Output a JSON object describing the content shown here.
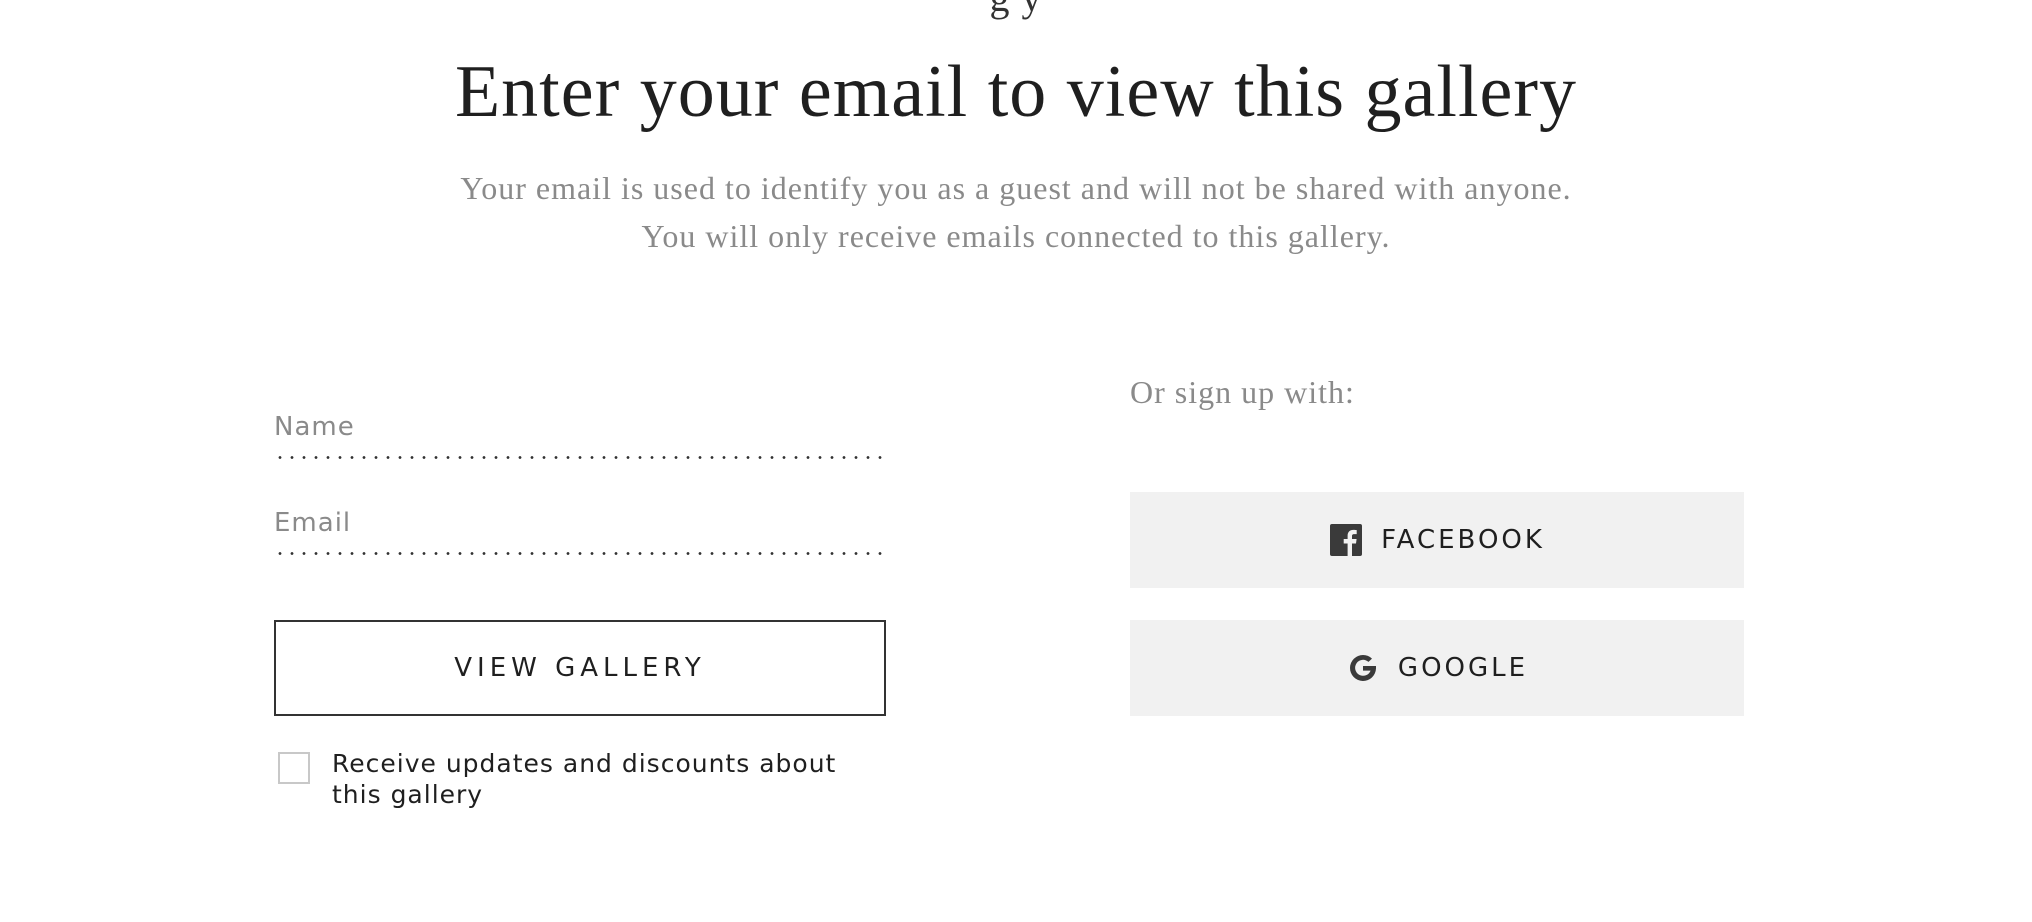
{
  "header": {
    "cut_text": "g    y",
    "title": "Enter your email to view this gallery",
    "subtitle_line1": "Your email is used to identify you as a guest and will not be shared with anyone.",
    "subtitle_line2": "You will only receive emails connected to this gallery."
  },
  "form": {
    "name_placeholder": "Name",
    "name_value": "",
    "email_placeholder": "Email",
    "email_value": "",
    "submit_label": "VIEW GALLERY",
    "checkbox_checked": false,
    "checkbox_label": "Receive updates and discounts about this gallery"
  },
  "social": {
    "heading": "Or sign up with:",
    "buttons": [
      {
        "label": "FACEBOOK",
        "icon": "facebook-icon"
      },
      {
        "label": "GOOGLE",
        "icon": "google-icon"
      }
    ]
  },
  "colors": {
    "text": "#1f1f1f",
    "muted": "#8a8a8a",
    "social_bg": "#f1f1f1",
    "border": "#333333"
  }
}
